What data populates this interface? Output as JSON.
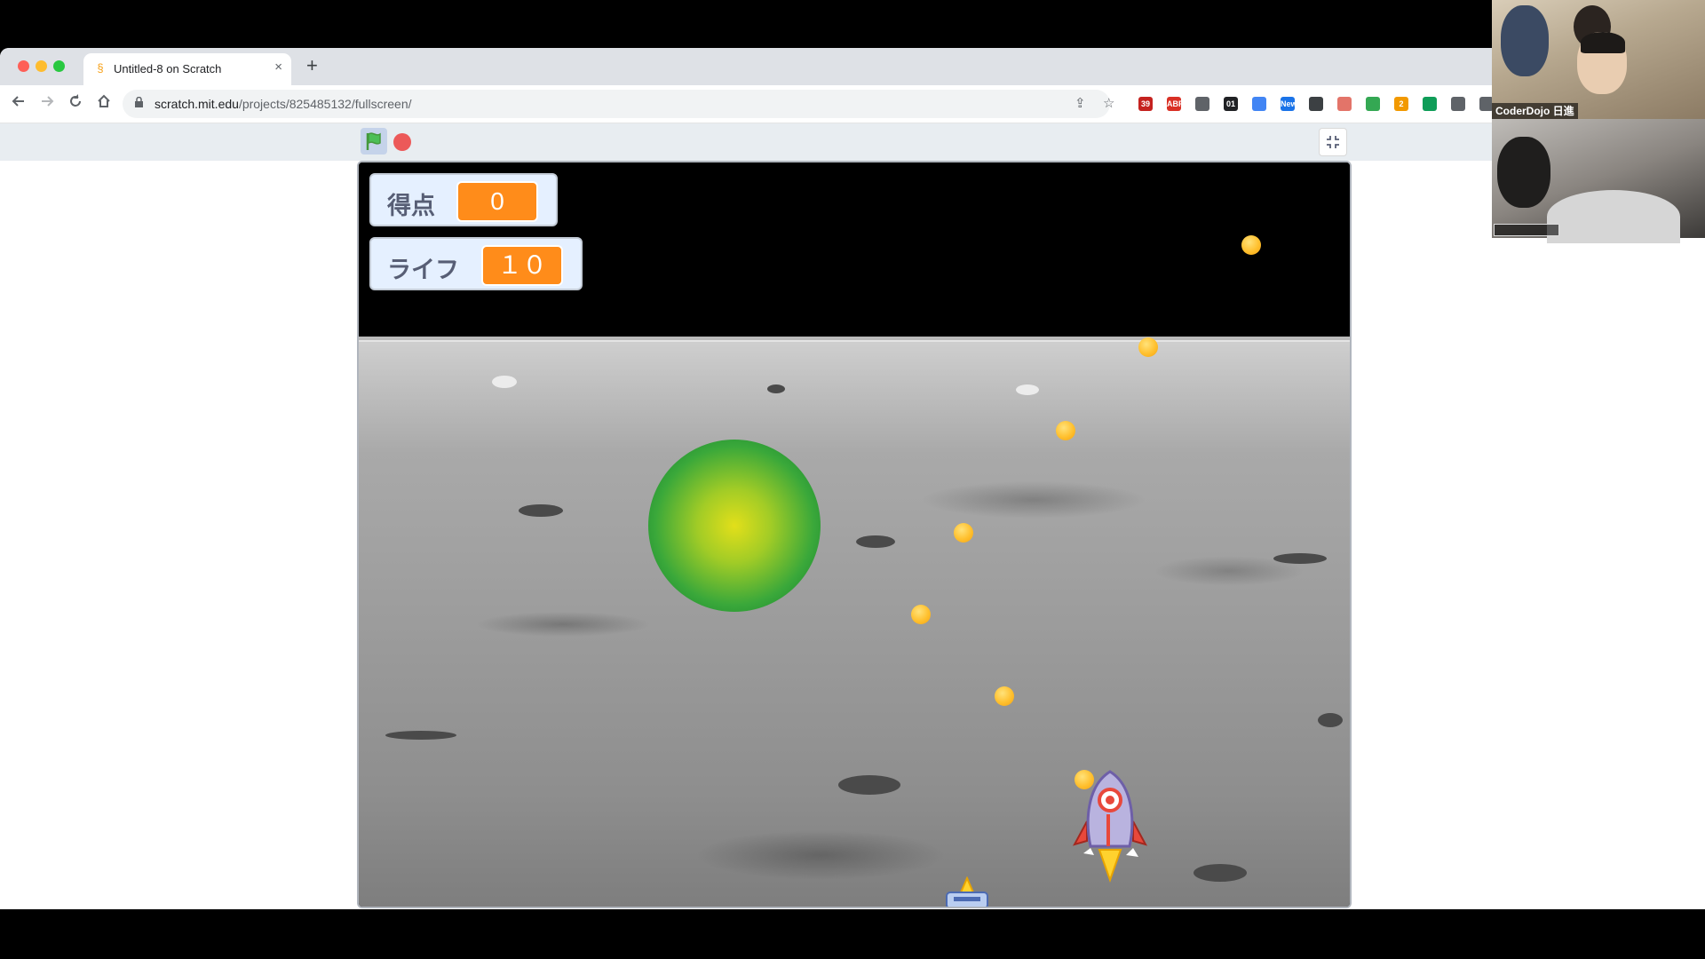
{
  "browser": {
    "tab_title": "Untitled-8 on Scratch",
    "new_tab_icon": "+",
    "close_icon": "×",
    "url_host": "scratch.mit.edu",
    "url_path": "/projects/825485132/fullscreen/",
    "extensions": [
      {
        "name": "gmail-icon",
        "color": "#c5221f",
        "badge": "39"
      },
      {
        "name": "adblock-icon",
        "color": "#d93025",
        "badge": "ABP"
      },
      {
        "name": "sync-icon",
        "color": "#5f6368",
        "badge": ""
      },
      {
        "name": "counter-icon",
        "color": "#202124",
        "badge": "01"
      },
      {
        "name": "google-extension-icon",
        "color": "#4285f4",
        "badge": ""
      },
      {
        "name": "news-icon",
        "color": "#1a73e8",
        "badge": "New"
      },
      {
        "name": "gear-extension-icon",
        "color": "#3c4043",
        "badge": ""
      },
      {
        "name": "shield-extension-icon",
        "color": "#e37469",
        "badge": ""
      },
      {
        "name": "diamond-extension-icon",
        "color": "#34a853",
        "badge": ""
      },
      {
        "name": "extension-badge-icon",
        "color": "#f29900",
        "badge": "2"
      },
      {
        "name": "green-square-icon",
        "color": "#0f9d58",
        "badge": ""
      },
      {
        "name": "doc-extension-icon",
        "color": "#5f6368",
        "badge": ""
      },
      {
        "name": "grid-extension-icon",
        "color": "#5f6368",
        "badge": ""
      }
    ]
  },
  "game": {
    "score_label": "得点",
    "score_value": "0",
    "life_label": "ライフ",
    "life_value": "１０"
  },
  "video_call": {
    "participant_name": "CoderDojo 日進"
  }
}
